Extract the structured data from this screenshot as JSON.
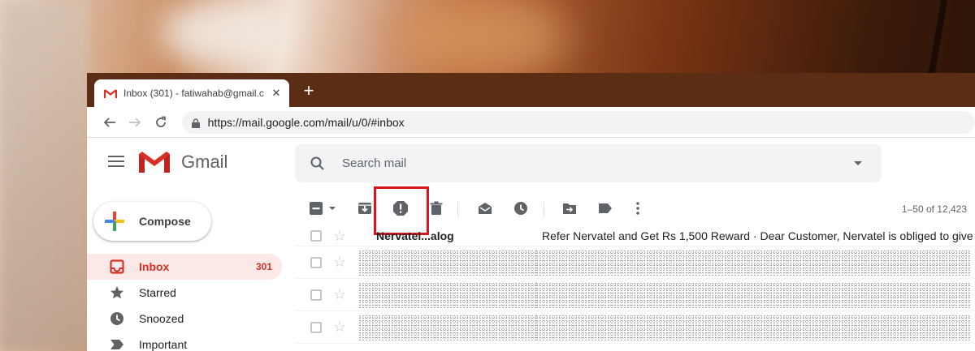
{
  "browser": {
    "tab_title": "Inbox (301) - fatiwahab@gmail.c",
    "tab_close": "✕",
    "new_tab": "+",
    "url": "https://mail.google.com/mail/u/0/#inbox"
  },
  "header": {
    "app_name": "Gmail",
    "search_placeholder": "Search mail"
  },
  "sidebar": {
    "compose_label": "Compose",
    "items": [
      {
        "label": "Inbox",
        "count": "301",
        "icon": "inbox-icon",
        "active": true
      },
      {
        "label": "Starred",
        "count": "",
        "icon": "star-icon",
        "active": false
      },
      {
        "label": "Snoozed",
        "count": "",
        "icon": "clock-icon",
        "active": false
      },
      {
        "label": "Important",
        "count": "",
        "icon": "important-icon",
        "active": false
      }
    ]
  },
  "toolbar": {
    "pager": "1–50 of 12,423",
    "icons": [
      "select-all-checkbox-icon",
      "select-dropdown-icon",
      "archive-icon",
      "report-spam-icon",
      "delete-icon",
      "mark-as-read-icon",
      "snooze-icon",
      "move-to-icon",
      "labels-icon",
      "more-icon"
    ]
  },
  "emails": [
    {
      "sender": "Nervatel...alog",
      "subject": "Refer Nervatel and Get Rs 1,500 Reward · Dear Customer, Nervatel is obliged to give"
    },
    {
      "sender": "",
      "subject": ""
    },
    {
      "sender": "",
      "subject": ""
    },
    {
      "sender": "",
      "subject": ""
    }
  ],
  "colors": {
    "accent": "#d93025",
    "active_bg": "#fce8e6",
    "highlight_box": "#d9161c",
    "tabstrip": "#5a2d14"
  }
}
